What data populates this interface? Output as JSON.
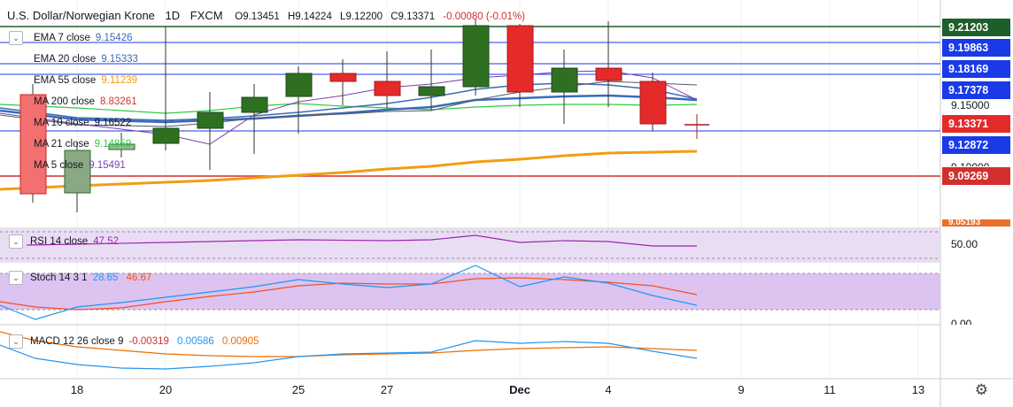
{
  "header": {
    "symbol": "U.S. Dollar/Norwegian Krone",
    "interval": "1D",
    "source": "FXCM",
    "open": "O9.13451",
    "high": "H9.14224",
    "low": "L9.12200",
    "close": "C9.13371",
    "change": "-0.00080 (-0.01%)"
  },
  "indicators": [
    {
      "label": "EMA 7 close",
      "value": "9.15426",
      "color": "#3b6bb8"
    },
    {
      "label": "EMA 20 close",
      "value": "9.15333",
      "color": "#3b6bb8"
    },
    {
      "label": "EMA 55 close",
      "value": "9.11239",
      "color": "#f39c12"
    },
    {
      "label": "MA 200 close",
      "value": "8.83261",
      "color": "#d32f2f"
    },
    {
      "label": "MA 10 close",
      "value": "9.16522",
      "color": "#131722"
    },
    {
      "label": "MA 21 close",
      "value": "9.14859",
      "color": "#2ecc40"
    },
    {
      "label": "MA 5 close",
      "value": "9.15491",
      "color": "#7b3fb0"
    }
  ],
  "price_axis": {
    "labels": [
      "9.15000",
      "9.10000",
      "50.00",
      "0.00"
    ],
    "tags": [
      {
        "value": "9.21203",
        "color": "#1e5e2a"
      },
      {
        "value": "9.19863",
        "color": "#1a3ae8"
      },
      {
        "value": "9.18169",
        "color": "#1a3ae8"
      },
      {
        "value": "9.17378",
        "color": "#1a3ae8"
      },
      {
        "value": "9.13371",
        "color": "#e52a2a"
      },
      {
        "value": "9.12872",
        "color": "#1a3ae8"
      },
      {
        "value": "9.09269",
        "color": "#d32f2f"
      },
      {
        "value": "9.05193",
        "color": "#e8702a"
      }
    ]
  },
  "rsi": {
    "label": "RSI 14 close",
    "value": "47.52",
    "color": "#9c27b0"
  },
  "stoch": {
    "label": "Stoch 14 3 1",
    "k": "28.65",
    "d": "46.67",
    "k_color": "#2196f3",
    "d_color": "#f4511e"
  },
  "macd": {
    "label": "MACD 12 26 close 9",
    "hist": "-0.00319",
    "macd": "0.00586",
    "signal": "0.00905",
    "hist_color": "#d32f2f",
    "macd_color": "#2196f3",
    "signal_color": "#ef6c00"
  },
  "dates": [
    "18",
    "20",
    "25",
    "27",
    "Dec",
    "4",
    "9",
    "11",
    "13"
  ],
  "settings_icon": "gear-icon"
}
